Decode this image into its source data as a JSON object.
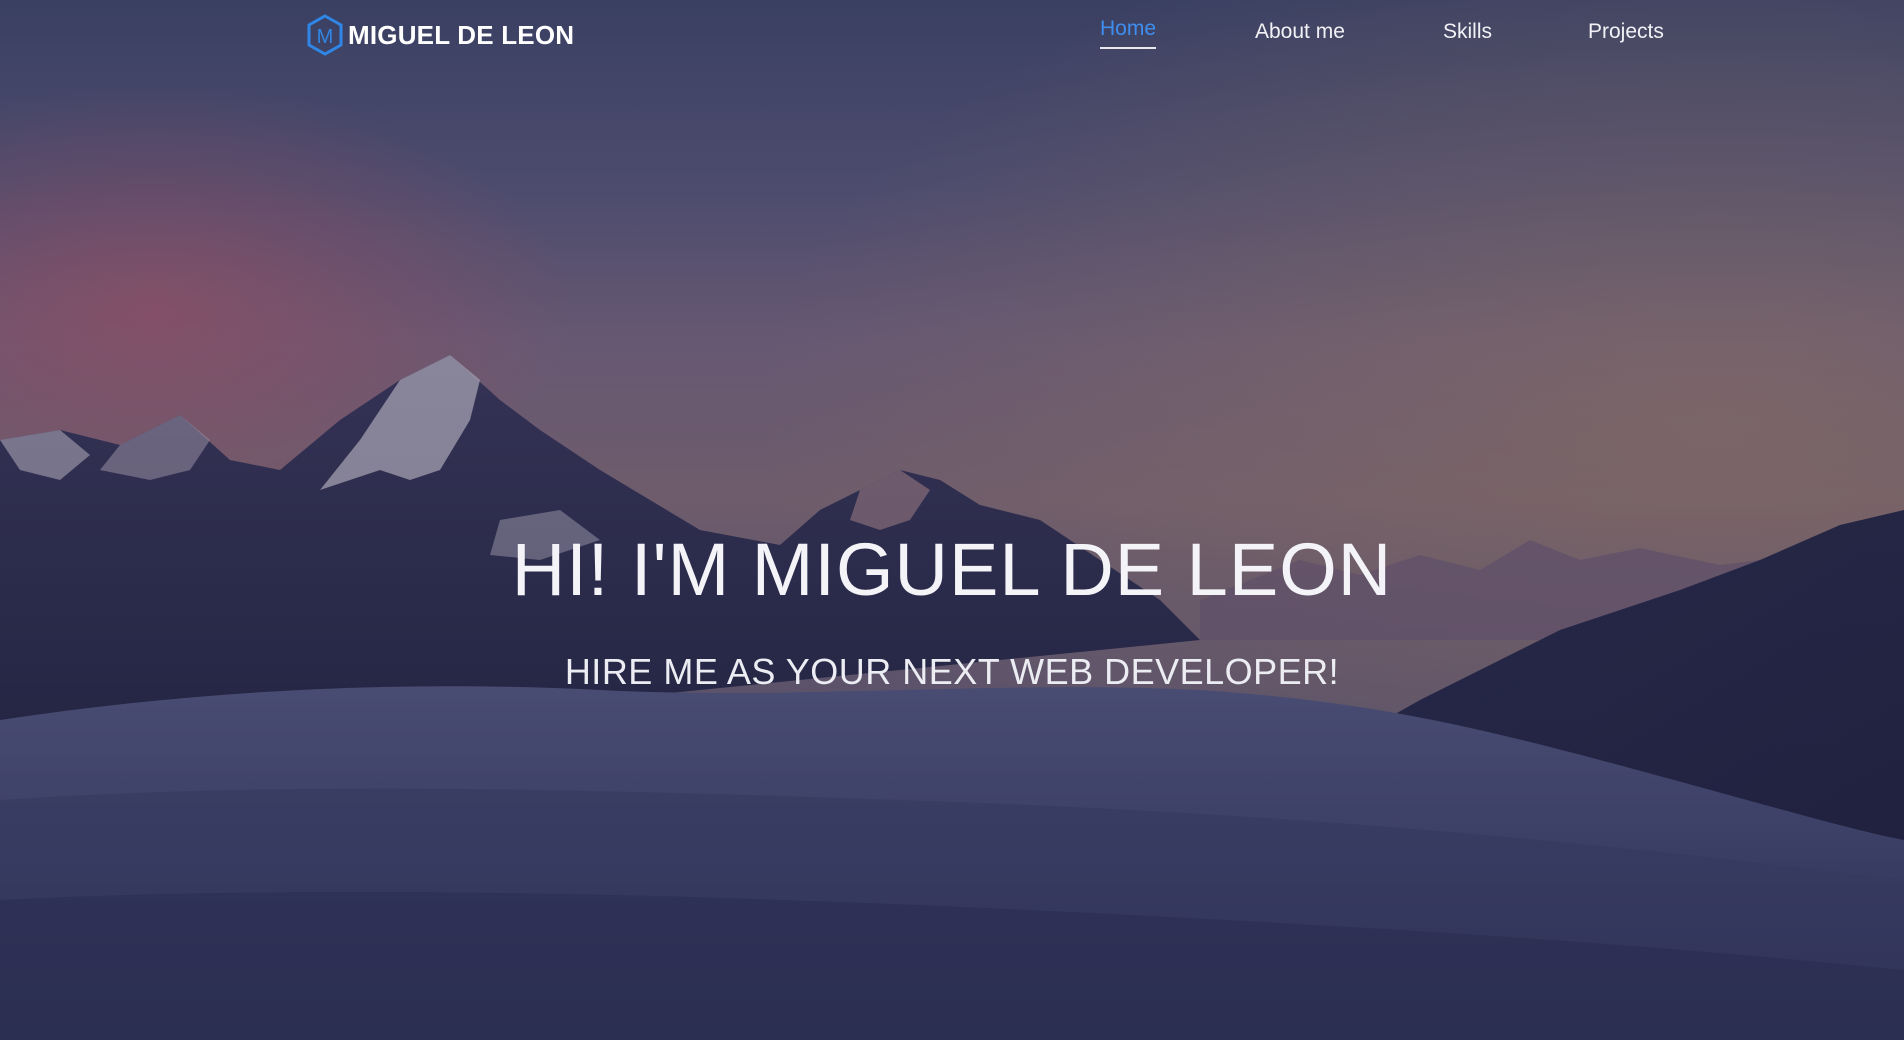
{
  "brand": {
    "name": "MIGUEL DE LEON",
    "logo_letter": "M",
    "logo_icon": "hexagon-m-logo-icon",
    "logo_color": "#2f86e6"
  },
  "nav": {
    "items": [
      {
        "label": "Home",
        "active": true
      },
      {
        "label": "About me",
        "active": false
      },
      {
        "label": "Skills",
        "active": false
      },
      {
        "label": "Projects",
        "active": false
      }
    ],
    "active_color": "#3e8ef0"
  },
  "hero": {
    "title": "HI! I'M MIGUEL DE LEON",
    "subtitle": "HIRE ME AS YOUR NEXT WEB DEVELOPER!",
    "background": "mountain-sunset-above-clouds"
  }
}
